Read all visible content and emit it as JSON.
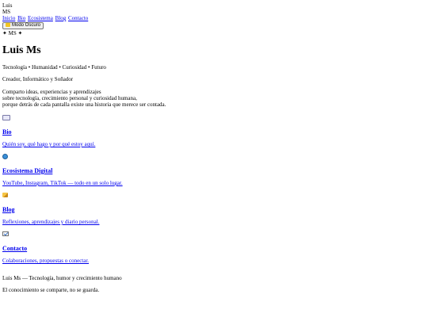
{
  "header": {
    "name_line1": "Luis",
    "name_line2": "MS"
  },
  "nav": {
    "items": [
      {
        "label": "Inicio"
      },
      {
        "label": "Bio"
      },
      {
        "label": "Ecosistema"
      },
      {
        "label": "Blog"
      },
      {
        "label": "Contacto"
      }
    ]
  },
  "theme_toggle": {
    "label": "Modo Oscuro",
    "icon": "moon-icon"
  },
  "hero": {
    "ms_tag": "✦ MS ✦",
    "title": "Luis Ms",
    "tagline": "Tecnología • Humanidad • Curiosidad • Futuro",
    "subtitle": "Creador, Informático y Soñador",
    "intro_lines": [
      "Comparto ideas, experiencias y aprendizajes",
      "sobre tecnología, crecimiento personal y curiosidad humana,",
      "porque detrás de cada pantalla existe una historia que merece ser contada."
    ]
  },
  "sections": [
    {
      "icon": "book-icon",
      "title": "Bio",
      "link": "Quién soy, qué hago y por qué estoy aquí."
    },
    {
      "icon": "globe-icon",
      "title": "Ecosistema Digital",
      "link": "YouTube, Instagram, TikTok — todo en un solo lugar."
    },
    {
      "icon": "pen-icon",
      "title": "Blog",
      "link": "Reflexiones, aprendizajes y diario personal."
    },
    {
      "icon": "mail-icon",
      "title": "Contacto",
      "link": "Colaboraciones, propuestas o conectar."
    }
  ],
  "footer": {
    "line1": "Luis Ms — Tecnología, humor y crecimiento humano",
    "line2": "El conocimiento se comparte, no se guarda."
  },
  "colors": {
    "link": "#0000ee",
    "text": "#000000",
    "background": "#ffffff"
  }
}
